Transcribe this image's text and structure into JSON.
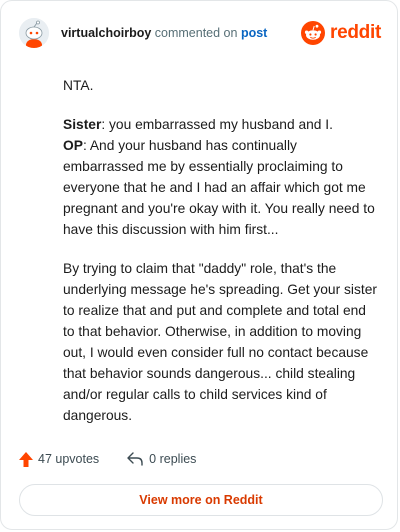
{
  "header": {
    "username": "virtualchoirboy",
    "action_text": "commented on",
    "post_link": "post",
    "brand_name": "reddit",
    "brand_color": "#ff4500"
  },
  "comment": {
    "line1": "NTA.",
    "sister_label": "Sister",
    "sister_text": ": you embarrassed my husband and I.",
    "op_label": "OP",
    "op_text": ": And your husband has continually embarrassed me by essentially proclaiming to everyone that he and I had an affair which got me pregnant and you're okay with it. You really need to have this discussion with him first...",
    "paragraph3": "By trying to claim that \"daddy\" role, that's the underlying message he's spreading. Get your sister to realize that and put and complete and total end to that behavior. Otherwise, in addition to moving out, I would even consider full no contact because that behavior sounds dangerous... child stealing and/or regular calls to child services kind of dangerous."
  },
  "stats": {
    "upvotes": "47 upvotes",
    "replies": "0 replies",
    "upvote_icon": "upvote-arrow-icon",
    "reply_icon": "reply-arrow-icon"
  },
  "footer": {
    "view_more": "View more on Reddit"
  }
}
